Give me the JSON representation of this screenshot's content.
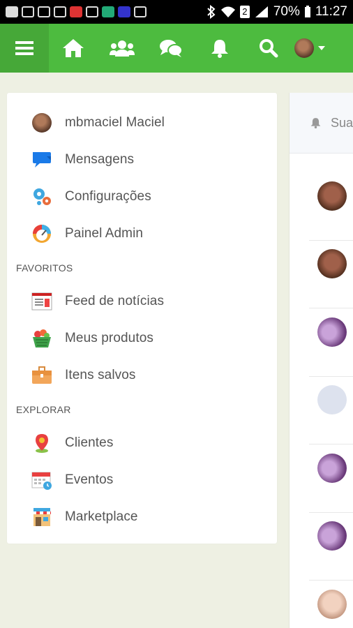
{
  "status_bar": {
    "battery": "70%",
    "time": "11:27",
    "sim_badge": "2"
  },
  "topbar": {
    "icons": [
      "menu-icon",
      "home-icon",
      "friends-icon",
      "chat-icon",
      "bell-icon",
      "search-icon",
      "avatar",
      "chevron-down-icon"
    ],
    "color": "#4dbb3f"
  },
  "sidebar": {
    "profile": {
      "label": "mbmaciel Maciel"
    },
    "items": [
      {
        "label": "Mensagens",
        "icon": "messages-icon"
      },
      {
        "label": "Configurações",
        "icon": "settings-gears-icon"
      },
      {
        "label": "Painel Admin",
        "icon": "dashboard-gauge-icon"
      }
    ],
    "favorites": {
      "title": "FAVORITOS",
      "items": [
        {
          "label": "Feed de notícias",
          "icon": "newsfeed-icon"
        },
        {
          "label": "Meus produtos",
          "icon": "basket-icon"
        },
        {
          "label": "Itens salvos",
          "icon": "briefcase-icon"
        }
      ]
    },
    "explore": {
      "title": "EXPLORAR",
      "items": [
        {
          "label": "Clientes",
          "icon": "map-pin-icon"
        },
        {
          "label": "Eventos",
          "icon": "calendar-icon"
        },
        {
          "label": "Marketplace",
          "icon": "store-icon"
        }
      ]
    }
  },
  "right_panel": {
    "header_text": "Sua"
  }
}
